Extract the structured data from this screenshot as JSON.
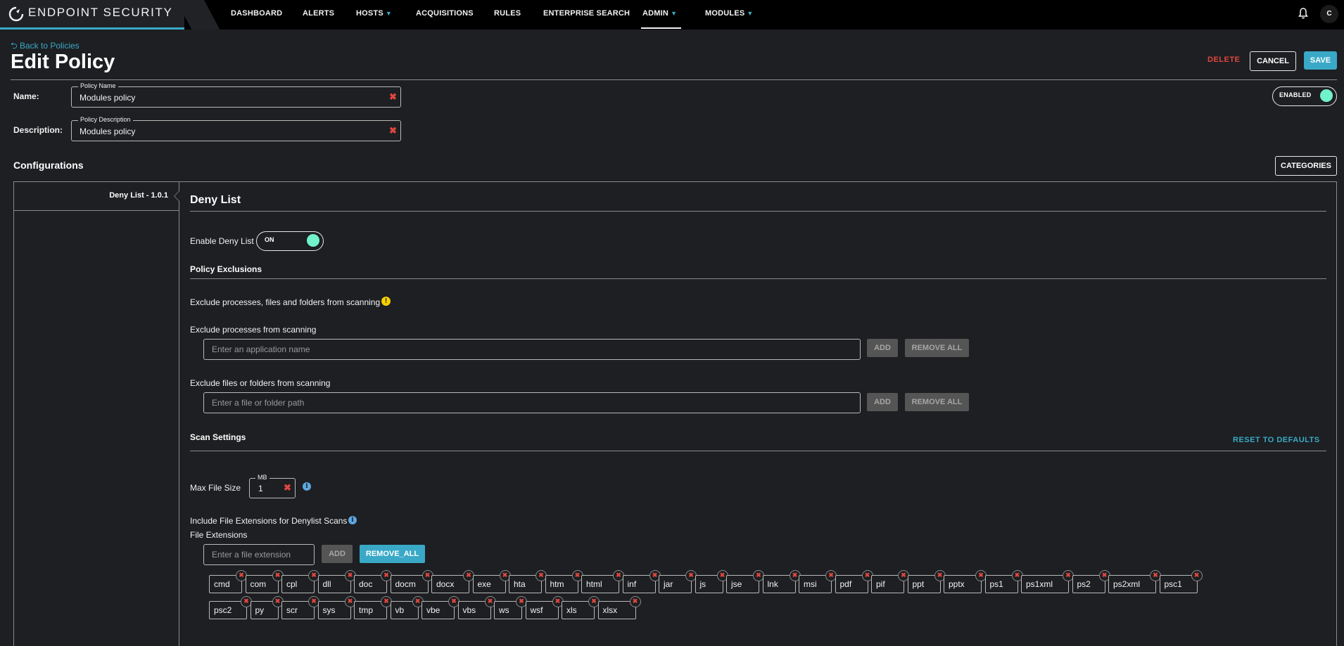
{
  "brand": {
    "name": "ENDPOINT SECURITY"
  },
  "nav": {
    "items": [
      {
        "label": "DASHBOARD"
      },
      {
        "label": "ALERTS"
      },
      {
        "label": "HOSTS"
      },
      {
        "label": "ACQUISITIONS"
      },
      {
        "label": "RULES"
      },
      {
        "label": "ENTERPRISE SEARCH"
      },
      {
        "label": "ADMIN"
      },
      {
        "label": "MODULES"
      }
    ],
    "active": "ADMIN",
    "avatar_initial": "C"
  },
  "header": {
    "back_label": "Back to Policies",
    "title": "Edit Policy",
    "delete_label": "DELETE",
    "cancel_label": "CANCEL",
    "save_label": "SAVE"
  },
  "policy": {
    "name_label": "Name:",
    "name_legend": "Policy Name",
    "name_value": "Modules policy",
    "description_label": "Description:",
    "description_legend": "Policy Description",
    "description_value": "Modules policy",
    "enabled_label": "ENABLED"
  },
  "configurations": {
    "title": "Configurations",
    "categories_label": "CATEGORIES",
    "left_item": "Deny List - 1.0.1"
  },
  "deny_list": {
    "title": "Deny List",
    "enable_label": "Enable Deny List",
    "toggle_label": "ON",
    "exclusions_title": "Policy Exclusions",
    "exclude_intro": "Exclude processes, files and folders from scanning",
    "processes_label": "Exclude processes from scanning",
    "processes_placeholder": "Enter an application name",
    "files_label": "Exclude files or folders from scanning",
    "files_placeholder": "Enter a file or folder path",
    "add_label": "ADD",
    "remove_all_label": "REMOVE ALL",
    "scan_settings_title": "Scan Settings",
    "reset_label": "RESET TO DEFAULTS",
    "max_file_size_label": "Max File Size",
    "max_file_size_unit": "MB",
    "max_file_size_value": "1",
    "include_ext_label": "Include File Extensions for Denylist Scans",
    "file_ext_label": "File Extensions",
    "ext_placeholder": "Enter a file extension",
    "ext_add_label": "ADD",
    "ext_remove_all_label": "REMOVE_ALL",
    "extensions_row1": [
      "cmd",
      "com",
      "cpl",
      "dll",
      "doc",
      "docm",
      "docx",
      "exe",
      "hta",
      "htm",
      "html",
      "inf",
      "jar",
      "js",
      "jse",
      "lnk",
      "msi",
      "pdf",
      "pif",
      "ppt",
      "pptx",
      "ps1",
      "ps1xml",
      "ps2",
      "ps2xml",
      "psc1"
    ],
    "extensions_row2": [
      "psc2",
      "py",
      "scr",
      "sys",
      "tmp",
      "vb",
      "vbe",
      "vbs",
      "ws",
      "wsf",
      "xls",
      "xlsx"
    ]
  }
}
